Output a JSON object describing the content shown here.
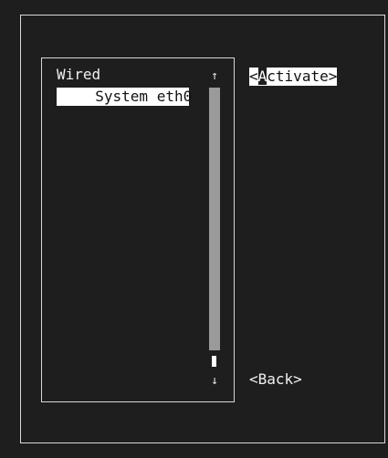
{
  "connections": {
    "group_label": "Wired",
    "items": [
      {
        "label": "  System eth0"
      }
    ]
  },
  "scrollbar": {
    "up_arrow": "↑",
    "down_arrow": "↓"
  },
  "buttons": {
    "activate": {
      "open": "<",
      "hotkey": "A",
      "rest": "ctivate>"
    },
    "back": "<Back>"
  }
}
